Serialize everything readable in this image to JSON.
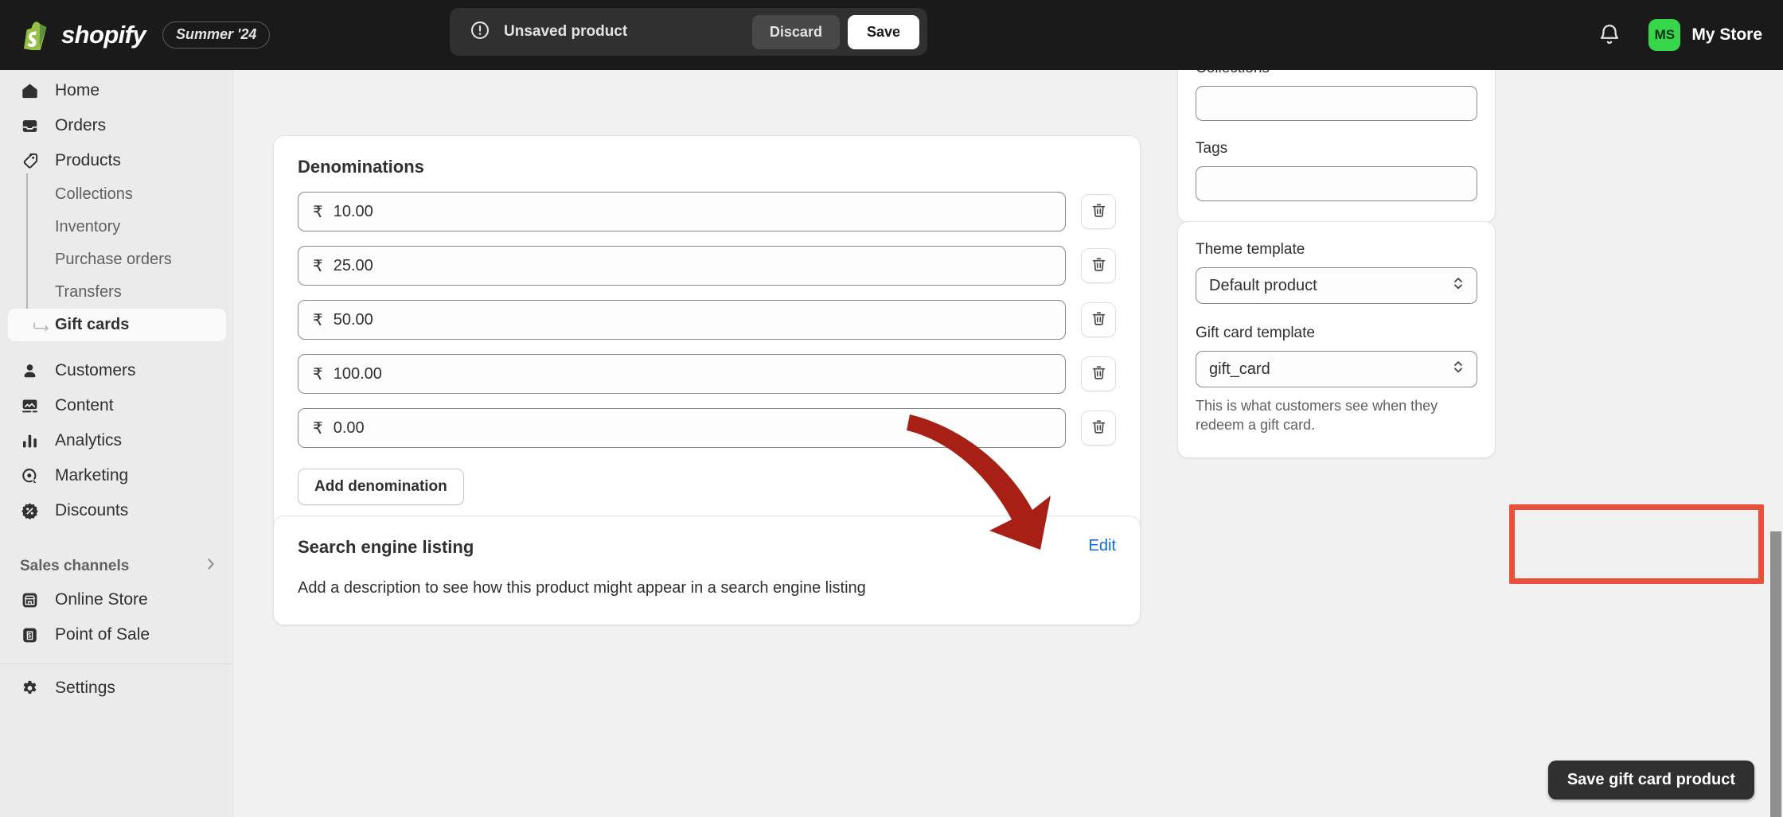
{
  "topbar": {
    "brand_name": "shopify",
    "version_badge": "Summer '24",
    "savebar": {
      "status_text": "Unsaved product",
      "discard_label": "Discard",
      "save_label": "Save"
    },
    "store_initials": "MS",
    "store_name": "My Store"
  },
  "sidebar": {
    "items": [
      {
        "label": "Home",
        "icon": "home-icon"
      },
      {
        "label": "Orders",
        "icon": "orders-icon"
      },
      {
        "label": "Products",
        "icon": "tag-icon"
      }
    ],
    "product_subitems": [
      {
        "label": "Collections"
      },
      {
        "label": "Inventory"
      },
      {
        "label": "Purchase orders"
      },
      {
        "label": "Transfers"
      },
      {
        "label": "Gift cards",
        "active": true
      }
    ],
    "items2": [
      {
        "label": "Customers",
        "icon": "customer-icon"
      },
      {
        "label": "Content",
        "icon": "content-icon"
      },
      {
        "label": "Analytics",
        "icon": "analytics-icon"
      },
      {
        "label": "Marketing",
        "icon": "marketing-icon"
      },
      {
        "label": "Discounts",
        "icon": "discount-icon"
      }
    ],
    "sales_channels_label": "Sales channels",
    "channels": [
      {
        "label": "Online Store",
        "icon": "storefront-icon"
      },
      {
        "label": "Point of Sale",
        "icon": "pos-icon"
      }
    ],
    "settings_label": "Settings"
  },
  "main": {
    "denominations": {
      "title": "Denominations",
      "currency_symbol": "₹",
      "values": [
        "10.00",
        "25.00",
        "50.00",
        "100.00",
        "0.00"
      ],
      "add_label": "Add denomination"
    },
    "seo": {
      "title": "Search engine listing",
      "edit_label": "Edit",
      "body": "Add a description to see how this product might appear in a search engine listing"
    }
  },
  "right_panel": {
    "organization": {
      "collections_label": "Collections",
      "collections_value": "",
      "tags_label": "Tags",
      "tags_value": ""
    },
    "templates": {
      "theme_template_label": "Theme template",
      "theme_template_value": "Default product",
      "gift_card_template_label": "Gift card template",
      "gift_card_template_value": "gift_card",
      "help_text": "This is what customers see when they redeem a gift card."
    }
  },
  "annotation": {
    "save_gift_card_label": "Save gift card product",
    "highlight_color": "#e8503a",
    "arrow_color": "#a81f16"
  }
}
